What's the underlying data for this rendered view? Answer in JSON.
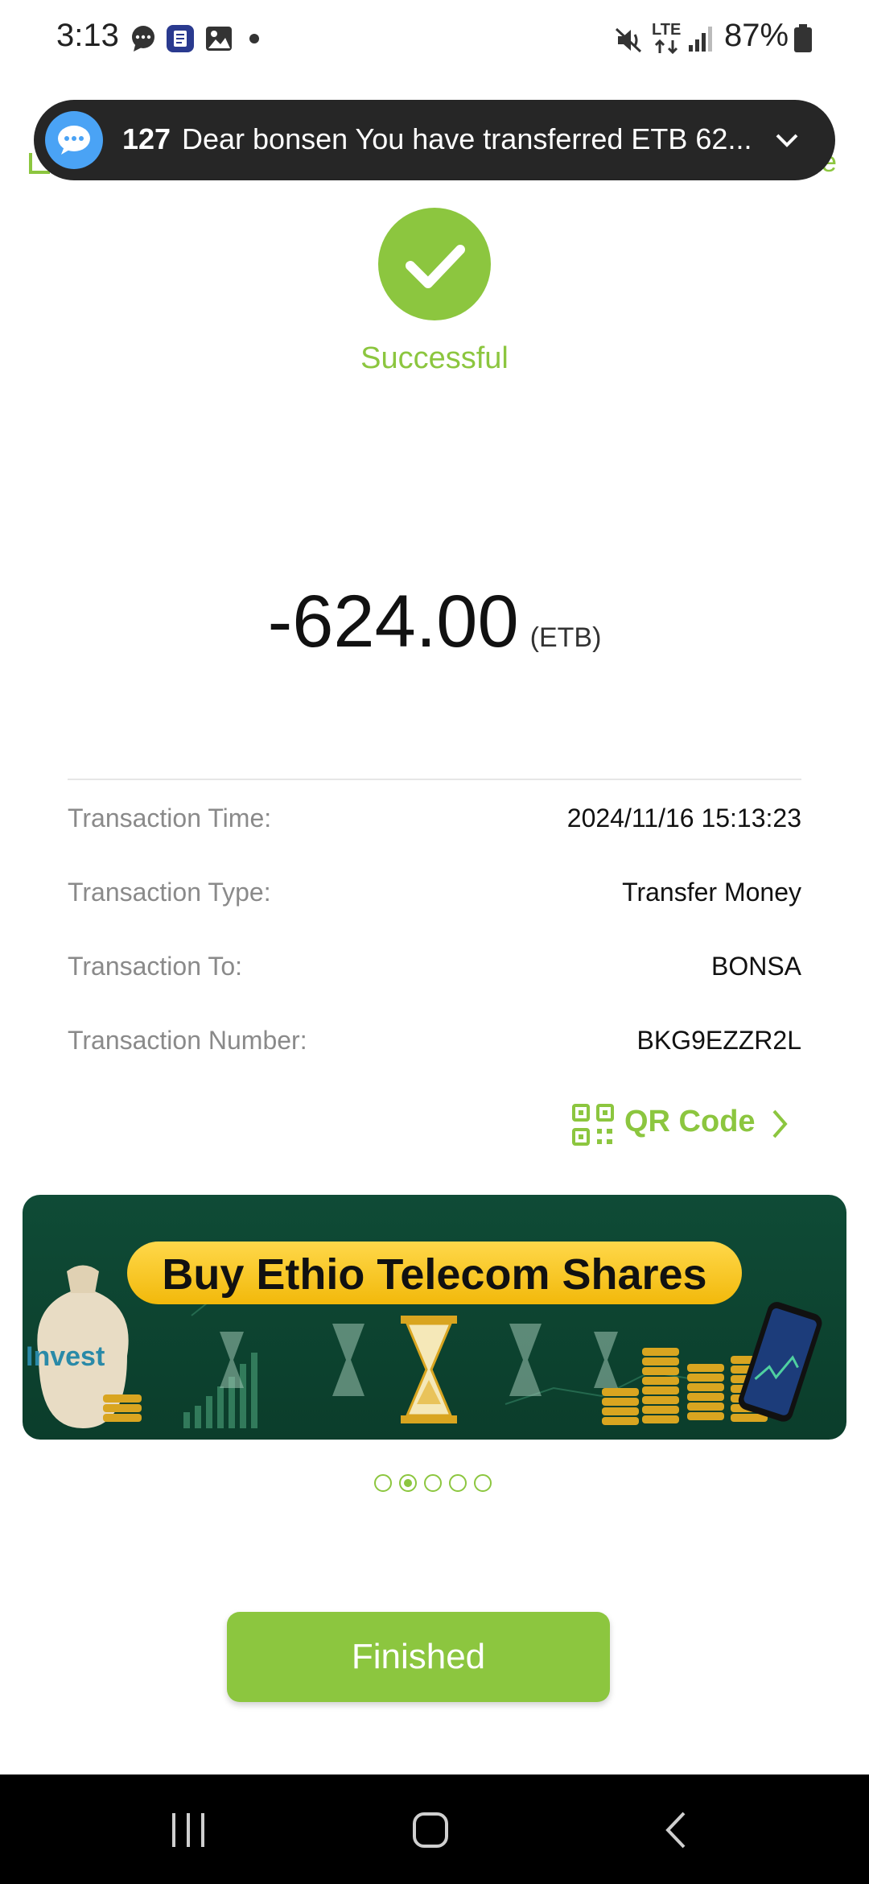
{
  "status_bar": {
    "time": "3:13",
    "battery": "87%",
    "network": "LTE"
  },
  "notification": {
    "count": "127",
    "text": "Dear bonsen  You have transferred ETB 62..."
  },
  "result": {
    "status": "Successful",
    "amount": "-624.00",
    "currency": "(ETB)"
  },
  "details": [
    {
      "label": "Transaction Time:",
      "value": "2024/11/16 15:13:23"
    },
    {
      "label": "Transaction Type:",
      "value": "Transfer Money"
    },
    {
      "label": "Transaction To:",
      "value": "BONSA"
    },
    {
      "label": "Transaction Number:",
      "value": "BKG9EZZR2L"
    }
  ],
  "qr_link": "QR Code",
  "banner": {
    "title": "Buy Ethio Telecom Shares",
    "bag_text": "Invest"
  },
  "carousel": {
    "count": 5,
    "active_index": 1
  },
  "finish_label": "Finished",
  "colors": {
    "accent": "#8cc63f",
    "notification_bg": "#262626"
  }
}
